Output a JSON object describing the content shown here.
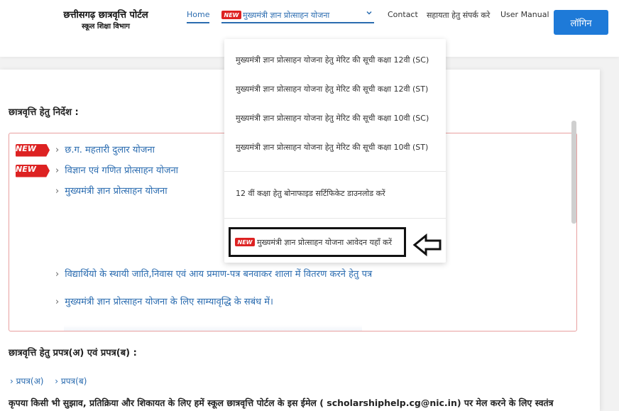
{
  "header": {
    "brand_title": "छत्तीसगढ़ छात्रवृत्ति पोर्टल",
    "brand_subtitle": "स्कूल शिक्षा विभाग",
    "nav": {
      "home": "Home",
      "new_badge": "NEW",
      "dropdown_label": "मुख्यमंत्री ज्ञान प्रोत्साहन योजना",
      "contact": "Contact",
      "help": "सहायता हेतु संपर्क करे",
      "manual": "User Manual"
    },
    "login_label": "लॉगिन"
  },
  "dropdown_menu": {
    "items": [
      "मुख्यमंत्री ज्ञान प्रोत्साहन योजना हेतु मेरिट की सूची कक्षा 12वी (SC)",
      "मुख्यमंत्री ज्ञान प्रोत्साहन योजना हेतु मेरिट की सूची कक्षा 12वी (ST)",
      "मुख्यमंत्री ज्ञान प्रोत्साहन योजना हेतु मेरिट की सूची कक्षा 10वी (SC)",
      "मुख्यमंत्री ज्ञान प्रोत्साहन योजना हेतु मेरिट की सूची कक्षा 10वी (ST)",
      "12 वीं कक्षा हेतु बोनाफाइड सर्टिफिकेट डाउनलोड करें"
    ],
    "highlighted_badge": "NEW",
    "highlighted_item": "मुख्यमंत्री ज्ञान प्रोत्साहन योजना आवेदन यहाँ करें"
  },
  "main": {
    "instructions_heading": "छात्रवृत्ति हेतु निर्देश :",
    "notices": [
      {
        "badge": "NEW",
        "label": "छ.ग. महतारी दुलार योजना"
      },
      {
        "badge": "NEW",
        "label": "विज्ञान एवं गणित प्रोत्साहन योजना"
      },
      {
        "badge": "",
        "label": "मुख्यमंत्री ज्ञान प्रोत्साहन योजना"
      },
      {
        "badge": "",
        "label": "विद्यार्थियो के स्थायी जाति,निवास एवं आय प्रमाण-पत्र बनवाकर शाला में वितरण करने हेतु पत्र"
      },
      {
        "badge": "",
        "label": "मुख्यमंत्री ज्ञान प्रोत्साहन योजना  के लिए साम्यावृद्धि के सबंध में।"
      }
    ],
    "forms_heading": "छात्रवृत्ति हेतु प्रपत्र(अ) एवं प्रपत्र(ब) :",
    "form_links": [
      "प्रपत्र(अ)",
      "प्रपत्र(ब)"
    ],
    "footer_text": "कृपया किसी भी सुझाव, प्रतिक्रिया और शिकायत के लिए हमें स्कूल छात्रवृत्ति पोर्टल के इस ईमेल ( scholarshiphelp.cg@nic.in) पर मेल करने के लिए स्वतंत्र"
  },
  "colors": {
    "accent": "#2b6cb0",
    "login": "#1e7ad8",
    "badge": "#dd2222",
    "notice_border": "#e8a0a0"
  },
  "icons": {
    "dropdown_chevron": "chevron-down-icon",
    "list_bullet": "chevron-right-icon",
    "pointer": "left-arrow-icon"
  }
}
